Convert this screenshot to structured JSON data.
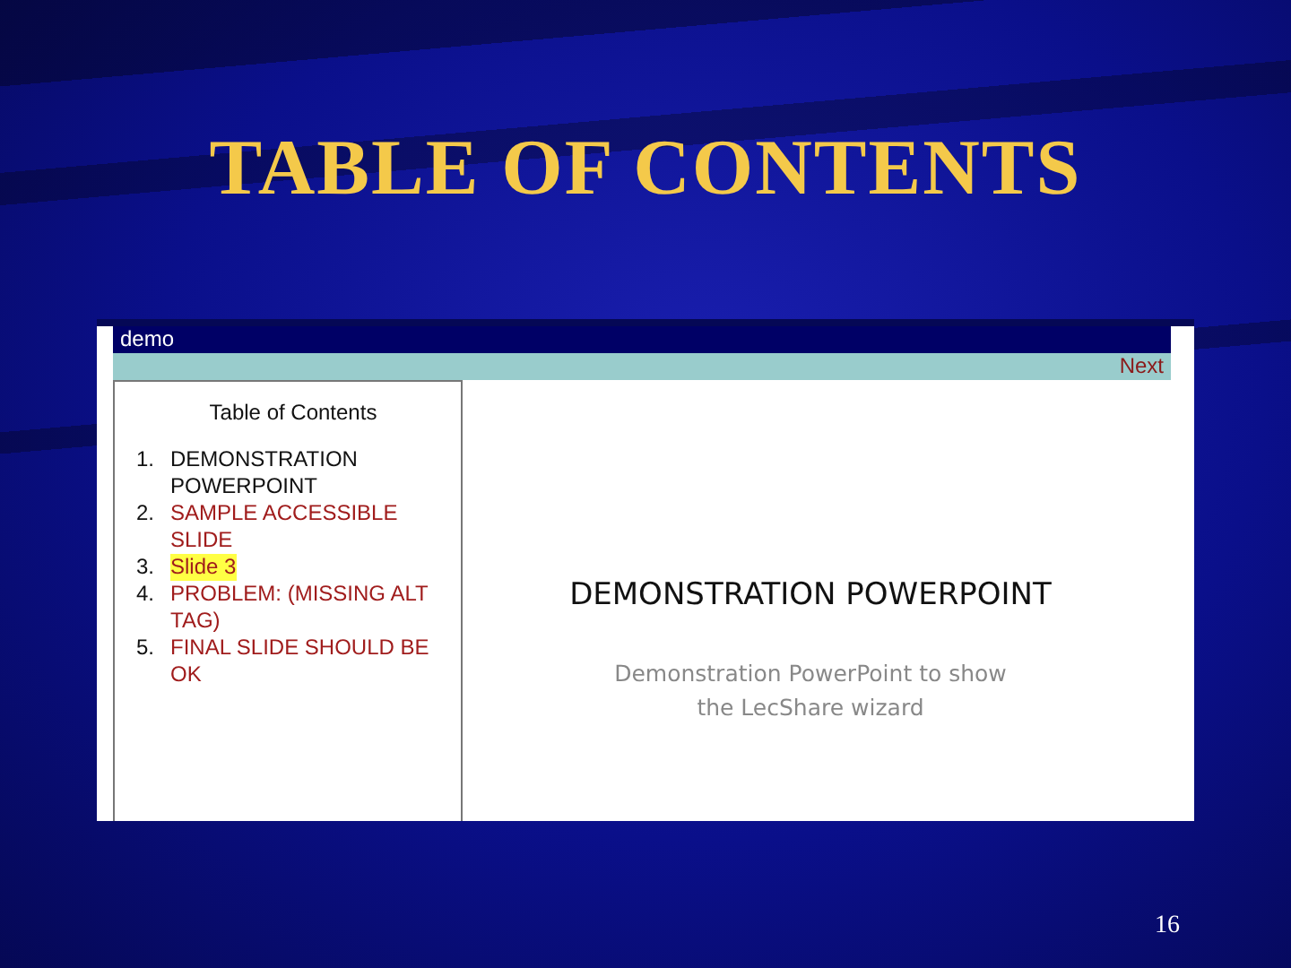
{
  "slide": {
    "title": "TABLE OF CONTENTS",
    "page_number": "16"
  },
  "viewer": {
    "header": "demo",
    "next_link": "Next",
    "toc": {
      "heading": "Table of Contents",
      "items": [
        {
          "number": "1.",
          "label": "DEMONSTRATION POWERPOINT",
          "current": true,
          "selected": false
        },
        {
          "number": "2.",
          "label": "SAMPLE ACCESSIBLE SLIDE",
          "current": false,
          "selected": false
        },
        {
          "number": "3.",
          "label": "Slide 3",
          "current": false,
          "selected": true
        },
        {
          "number": "4.",
          "label": "PROBLEM: (MISSING ALT TAG)",
          "current": false,
          "selected": false
        },
        {
          "number": "5.",
          "label": "FINAL SLIDE SHOULD BE OK",
          "current": false,
          "selected": false
        }
      ]
    },
    "preview": {
      "title": "DEMONSTRATION POWERPOINT",
      "subtitle": "Demonstration PowerPoint to show the LecShare wizard"
    }
  }
}
